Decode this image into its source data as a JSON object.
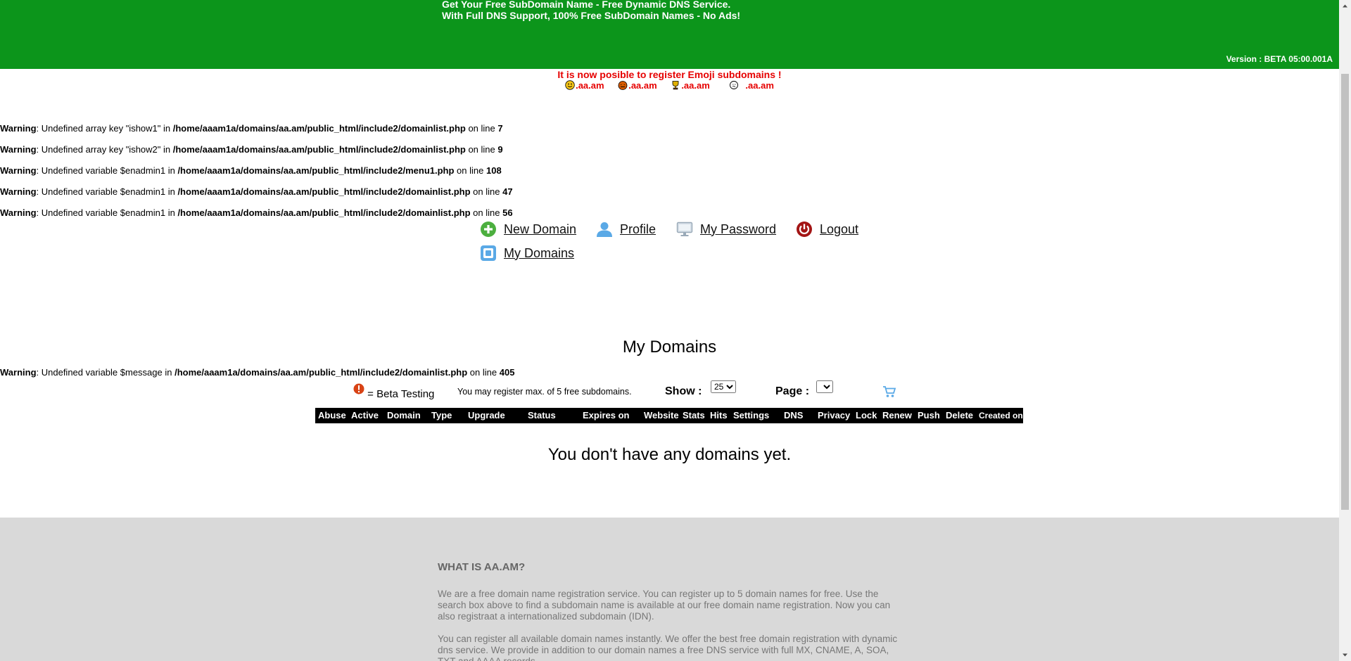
{
  "header": {
    "tagline_line1": "Get Your Free SubDomain Name - Free Dynamic DNS Service.",
    "tagline_line2": "With Full DNS Support, 100% Free SubDomain Names - No Ads!",
    "version": "Version : BETA 05:00.001A",
    "background_color": "#0c951b"
  },
  "notice": {
    "text": "It is now posible to register Emoji subdomains !",
    "emoji_domains": [
      ".aa.am",
      ".aa.am",
      ".aa.am",
      ".aa.am"
    ],
    "emoji_icons": [
      "smiley-emoji-icon",
      "pumpkin-emoji-icon",
      "trophy-emoji-icon",
      "double-face-emoji-icon"
    ]
  },
  "warnings": [
    {
      "label": "Warning",
      "msg": ": Undefined array key \"ishow1\" in ",
      "path": "/home/aaam1a/domains/aa.am/public_html/include2/domainlist.php",
      "online": " on line ",
      "line": "7"
    },
    {
      "label": "Warning",
      "msg": ": Undefined array key \"ishow2\" in ",
      "path": "/home/aaam1a/domains/aa.am/public_html/include2/domainlist.php",
      "online": " on line ",
      "line": "9"
    },
    {
      "label": "Warning",
      "msg": ": Undefined variable $enadmin1 in ",
      "path": "/home/aaam1a/domains/aa.am/public_html/include2/menu1.php",
      "online": " on line ",
      "line": "108"
    },
    {
      "label": "Warning",
      "msg": ": Undefined variable $enadmin1 in ",
      "path": "/home/aaam1a/domains/aa.am/public_html/include2/domainlist.php",
      "online": " on line ",
      "line": "47"
    },
    {
      "label": "Warning",
      "msg": ": Undefined variable $enadmin1 in ",
      "path": "/home/aaam1a/domains/aa.am/public_html/include2/domainlist.php",
      "online": " on line ",
      "line": "56"
    },
    {
      "label": "Warning",
      "msg": ": Undefined variable $message in ",
      "path": "/home/aaam1a/domains/aa.am/public_html/include2/domainlist.php",
      "online": " on line ",
      "line": "405"
    }
  ],
  "menu": {
    "new_domain": "New Domain",
    "profile": "Profile",
    "my_password": "My Password",
    "logout": "Logout",
    "my_domains": "My Domains"
  },
  "section": {
    "title": "My Domains",
    "beta_legend": "= Beta Testing",
    "register_note": "You may register max. of 5 free subdomains.",
    "show_label": "Show :",
    "show_value": "25",
    "page_label": "Page :",
    "page_value": ""
  },
  "table": {
    "columns": [
      "Abuse",
      "Active",
      "Domain",
      "Type",
      "Upgrade",
      "Status",
      "Expires on",
      "Website",
      "Stats",
      "Hits",
      "Settings",
      "DNS",
      "Privacy",
      "Lock",
      "Renew",
      "Push",
      "Delete",
      "Created on"
    ],
    "empty_message": "You don't have any domains yet."
  },
  "footer": {
    "title": "WHAT IS AA.AM?",
    "para1": "We are a free domain name registration service. You can register up to 5 domain names for free. Use the search box above to find a subdomain name is available at our free domain name registration. Now you can also registraat a internationalized subdomain (IDN).",
    "para2": "You can register all available domain names instantly. We offer the best free domain registration with dynamic dns service. We provide in addition to our domain names a free DNS service with full MX, CNAME, A, SOA, TXT and AAAA records."
  }
}
